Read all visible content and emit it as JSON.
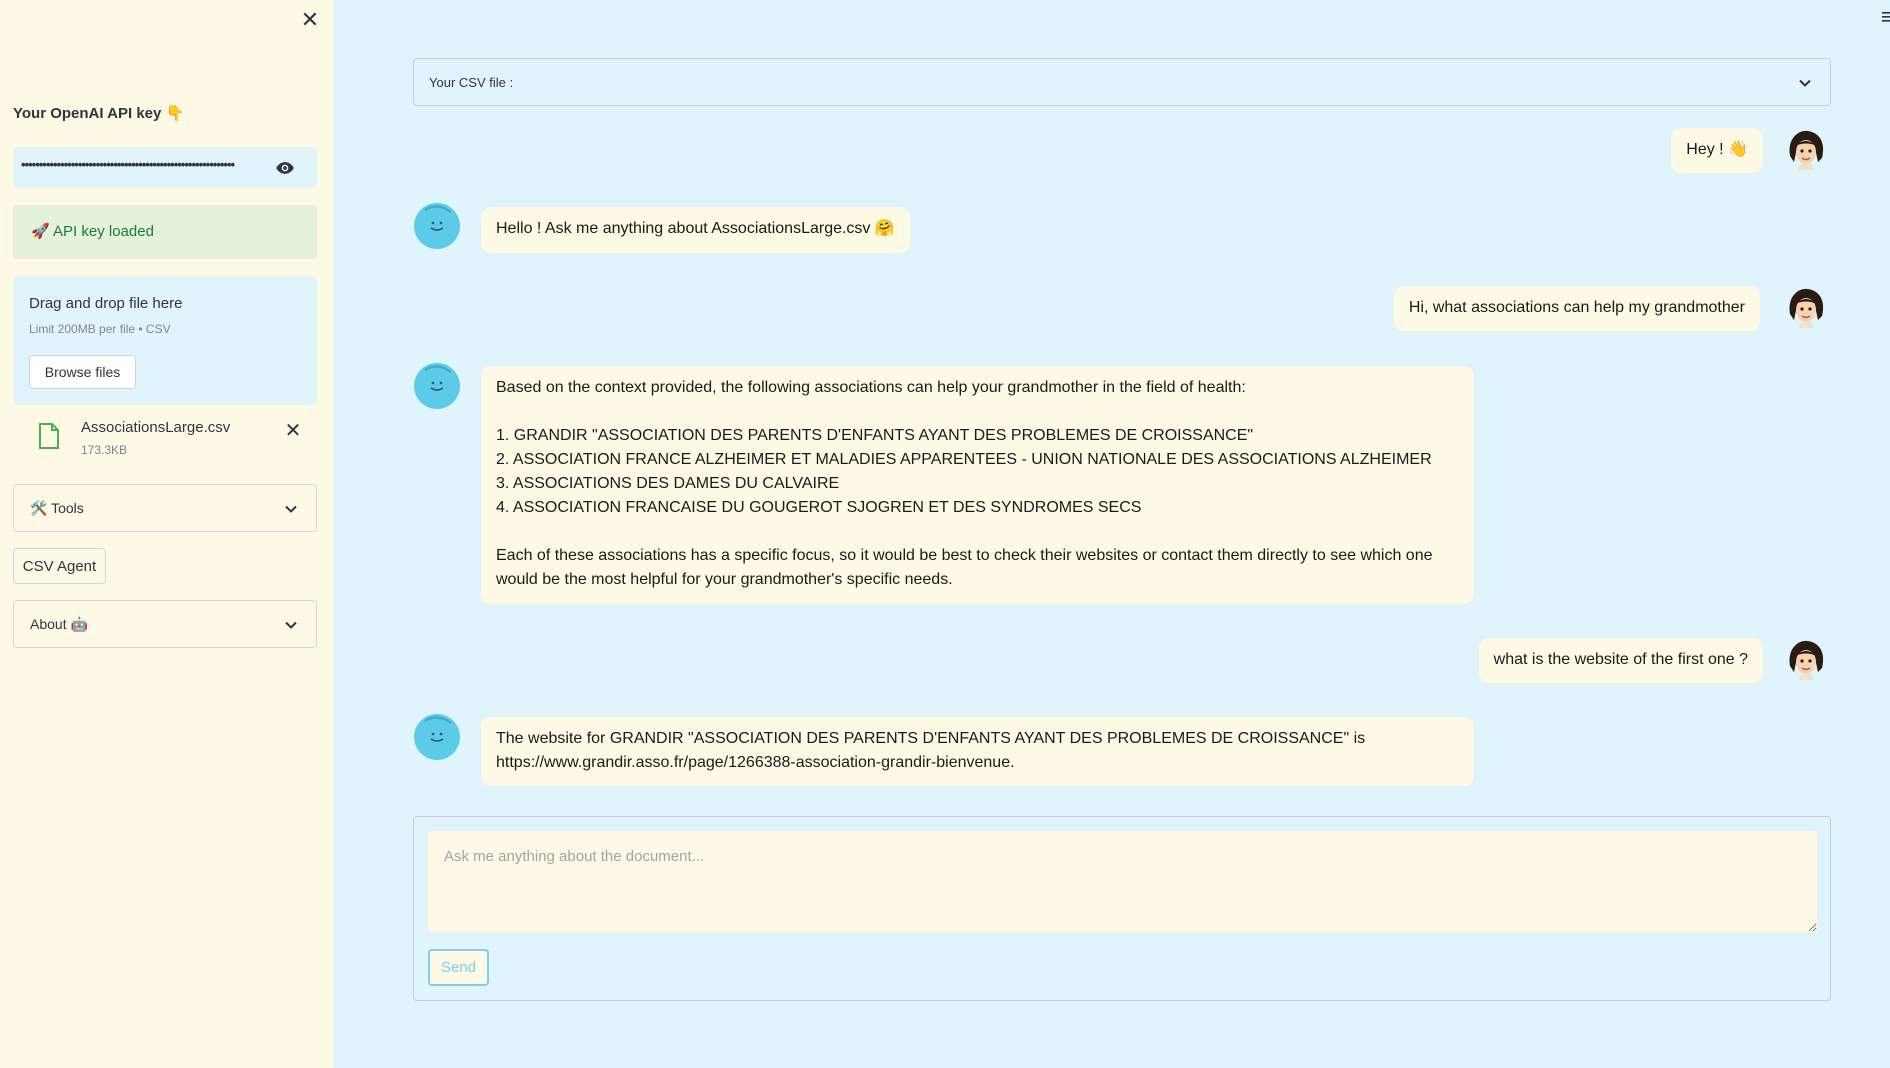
{
  "sidebar": {
    "close_glyph": "✕",
    "api_key_label": "Your OpenAI API key 👇",
    "api_key_value": "••••••••••••••••••••••••••••••••••••••••••••••••••••••••••••",
    "api_loaded_text": "🚀 API key loaded",
    "uploader": {
      "title": "Drag and drop file here",
      "limit": "Limit 200MB per file • CSV",
      "browse_label": "Browse files"
    },
    "uploaded_file": {
      "name": "AssociationsLarge.csv",
      "size": "173.3KB",
      "remove_glyph": "✕"
    },
    "tools_label": "🛠️ Tools",
    "csv_agent_label": "CSV Agent",
    "about_label": "About 🤖"
  },
  "main": {
    "csv_select_label": "Your CSV file :",
    "messages": [
      {
        "role": "user",
        "text": "Hey ! 👋"
      },
      {
        "role": "assistant",
        "text": "Hello ! Ask me anything about AssociationsLarge.csv 🤗"
      },
      {
        "role": "user",
        "text": "Hi, what associations can help my grandmother"
      },
      {
        "role": "assistant",
        "text": "Based on the context provided, the following associations can help your grandmother in the field of health:\n\n1. GRANDIR \"ASSOCIATION DES PARENTS D'ENFANTS AYANT DES PROBLEMES DE CROISSANCE\"\n2. ASSOCIATION FRANCE ALZHEIMER ET MALADIES APPARENTEES - UNION NATIONALE DES ASSOCIATIONS ALZHEIMER\n3. ASSOCIATIONS DES DAMES DU CALVAIRE\n4. ASSOCIATION FRANCAISE DU GOUGEROT SJOGREN ET DES SYNDROMES SECS\n\nEach of these associations has a specific focus, so it would be best to check their websites or contact them directly to see which one\nwould be the most helpful for your grandmother's specific needs."
      },
      {
        "role": "user",
        "text": "what is the website of the first one ?"
      },
      {
        "role": "assistant",
        "text": "The website for GRANDIR \"ASSOCIATION DES PARENTS D'ENFANTS AYANT DES PROBLEMES DE CROISSANCE\" is\nhttps://www.grandir.asso.fr/page/1266388-association-grandir-bienvenue."
      }
    ],
    "input_placeholder": "Ask me anything about the document...",
    "send_label": "Send"
  },
  "colors": {
    "background": "#e0f5fb",
    "sidebar": "#fdf9e4",
    "bubble": "#fdf9e4",
    "success_bg": "#e3f2d9",
    "success_text": "#1d7a3a",
    "accent": "#7fd0ee",
    "bot_avatar": "#5ccbe8"
  }
}
